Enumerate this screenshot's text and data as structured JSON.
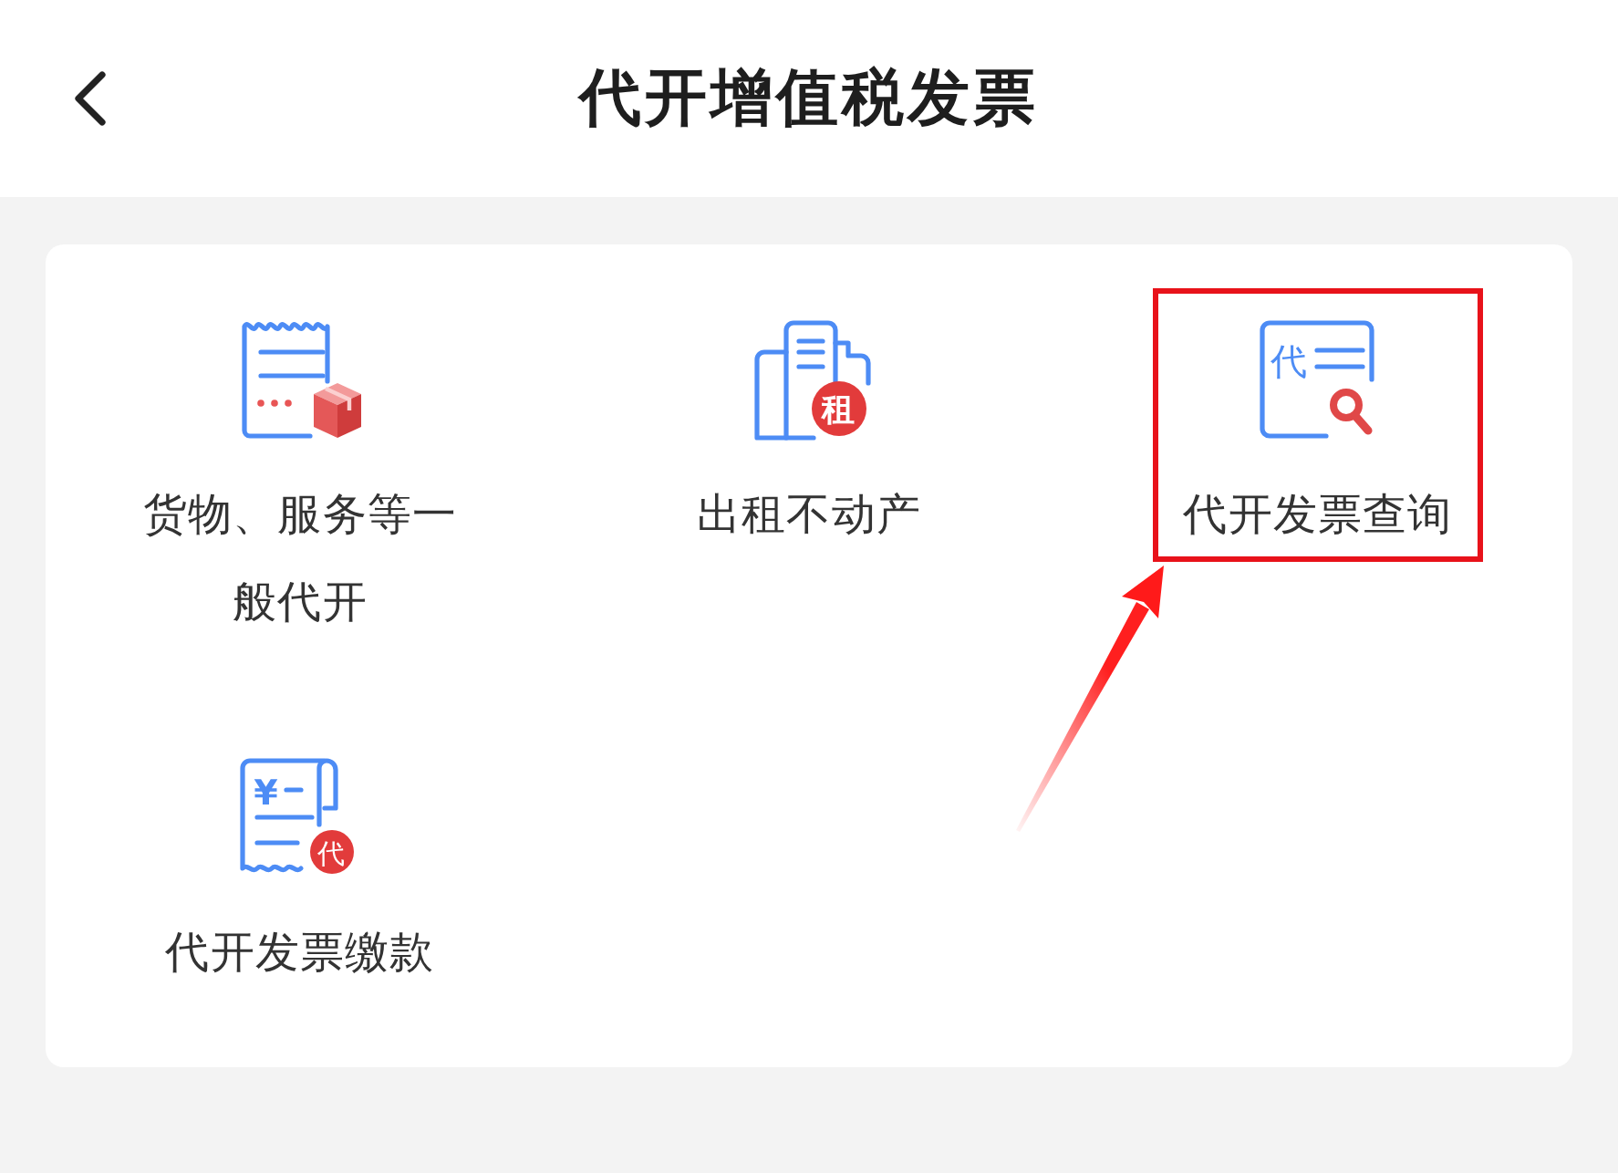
{
  "header": {
    "title": "代开增值税发票"
  },
  "services": [
    {
      "kind": "goods",
      "label": "货物、服务等一般代开",
      "highlighted": false
    },
    {
      "kind": "rental",
      "label": "出租不动产",
      "icon_text": "租",
      "highlighted": false
    },
    {
      "kind": "query",
      "label": "代开发票查询",
      "icon_text": "代",
      "highlighted": true
    },
    {
      "kind": "payment",
      "label": "代开发票缴款",
      "icon_text": "代",
      "icon_symbol": "¥",
      "highlighted": false
    }
  ]
}
